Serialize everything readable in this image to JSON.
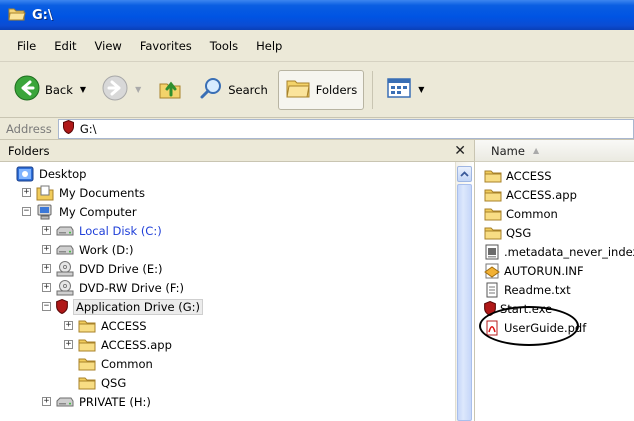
{
  "window": {
    "title": "G:\\"
  },
  "menu": [
    "File",
    "Edit",
    "View",
    "Favorites",
    "Tools",
    "Help"
  ],
  "toolbar": {
    "back_label": "Back",
    "search_label": "Search",
    "folders_label": "Folders"
  },
  "address": {
    "label": "Address",
    "value": "G:\\"
  },
  "folders_pane": {
    "header": "Folders",
    "close_glyph": "✕",
    "tree": [
      {
        "label": "Desktop",
        "icon": "desktop-icon",
        "expander": ""
      },
      {
        "label": "My Documents",
        "icon": "my-documents-icon",
        "expander": "+"
      },
      {
        "label": "My Computer",
        "icon": "my-computer-icon",
        "expander": "−"
      },
      {
        "label": "Local Disk (C:)",
        "icon": "hard-disk-icon",
        "expander": "+"
      },
      {
        "label": "Work (D:)",
        "icon": "hard-disk-icon",
        "expander": "+"
      },
      {
        "label": "DVD Drive (E:)",
        "icon": "dvd-drive-icon",
        "expander": "+"
      },
      {
        "label": "DVD-RW Drive (F:)",
        "icon": "dvd-drive-icon",
        "expander": "+"
      },
      {
        "label": "Application Drive (G:)",
        "icon": "shield-icon",
        "expander": "−"
      },
      {
        "label": "ACCESS",
        "icon": "folder-icon",
        "expander": "+"
      },
      {
        "label": "ACCESS.app",
        "icon": "folder-icon",
        "expander": "+"
      },
      {
        "label": "Common",
        "icon": "folder-icon",
        "expander": ""
      },
      {
        "label": "QSG",
        "icon": "folder-icon",
        "expander": ""
      },
      {
        "label": "PRIVATE (H:)",
        "icon": "hard-disk-icon",
        "expander": "+"
      }
    ]
  },
  "files_pane": {
    "column_name": "Name",
    "files": [
      {
        "name": "ACCESS",
        "icon": "folder-icon"
      },
      {
        "name": "ACCESS.app",
        "icon": "folder-icon"
      },
      {
        "name": "Common",
        "icon": "folder-icon"
      },
      {
        "name": "QSG",
        "icon": "folder-icon"
      },
      {
        "name": ".metadata_never_index",
        "icon": "document-icon"
      },
      {
        "name": "AUTORUN.INF",
        "icon": "autorun-icon"
      },
      {
        "name": "Readme.txt",
        "icon": "text-file-icon"
      },
      {
        "name": "Start.exe",
        "icon": "shield-icon"
      },
      {
        "name": "UserGuide.pdf",
        "icon": "pdf-icon"
      }
    ]
  },
  "colors": {
    "titlebar": "#0054e3",
    "link_blue": "#1f3fd8",
    "chrome": "#ece9d8"
  }
}
